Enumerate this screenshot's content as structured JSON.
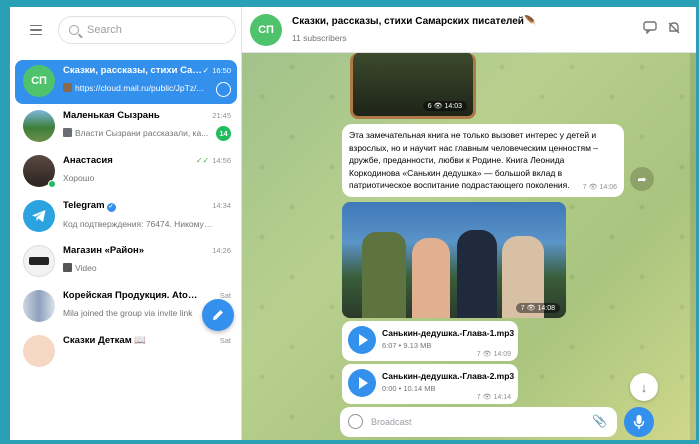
{
  "colors": {
    "accent": "#3390ec",
    "badge": "#20bd5f",
    "channel_avatar": "#4fc36b"
  },
  "sidebar": {
    "search_placeholder": "Search",
    "chats": [
      {
        "avatar": "СП",
        "title": "Сказки, рассказы, стихи Самар...",
        "time": "16:50",
        "preview": "https://cloud.mail.ru/public/JpTz/...",
        "read": true,
        "active": true
      },
      {
        "avatar": "",
        "title": "Маленькая Сызрань",
        "time": "21:45",
        "preview": "Власти Сызрани рассказали, ка...",
        "unread": "14"
      },
      {
        "avatar": "",
        "title": "Анастасия",
        "time": "14:56",
        "preview": "Хорошо",
        "read": true,
        "online": true
      },
      {
        "avatar": "",
        "title": "Telegram",
        "time": "14:34",
        "preview": "Код подтверждения: 76474. Никому не д...",
        "verified": true
      },
      {
        "avatar": "",
        "title": "Магазин «Район»",
        "time": "14:26",
        "preview": "Video"
      },
      {
        "avatar": "",
        "title": "Корейская Продукция. Atomy. LUX. A...",
        "time": "Sat",
        "preview": "Mila joined the group via invite link"
      },
      {
        "avatar": "",
        "title": "Сказки Деткам 📖",
        "time": "Sat",
        "preview": ""
      }
    ]
  },
  "channel": {
    "avatar": "СП",
    "title": "Сказки, рассказы, стихи Самарских писателей🪶",
    "subscribers": "11 subscribers"
  },
  "messages": {
    "image1": {
      "views": "6",
      "time": "14:03"
    },
    "text": {
      "body": "Эта замечательная книга не только вызовет интерес у детей и взрослых, но и научит нас главным человеческим ценностям – дружбе, преданности, любви к Родине. Книга Леонида Коркодинова «Санькин дедушка» — большой вклад в патриотическое воспитание подрастающего поколения.",
      "views": "7",
      "time": "14:06"
    },
    "image2": {
      "views": "7",
      "time": "14:08"
    },
    "audio": [
      {
        "title": "Санькин-дедушка.-Глава-1.mp3",
        "sub": "6:07 • 9.13 MB",
        "views": "7",
        "time": "14:09"
      },
      {
        "title": "Санькин-дедушка.-Глава-2.mp3",
        "sub": "0:00 • 10.14 MB",
        "views": "7",
        "time": "14:14"
      }
    ]
  },
  "composer": {
    "placeholder": "Broadcast"
  }
}
